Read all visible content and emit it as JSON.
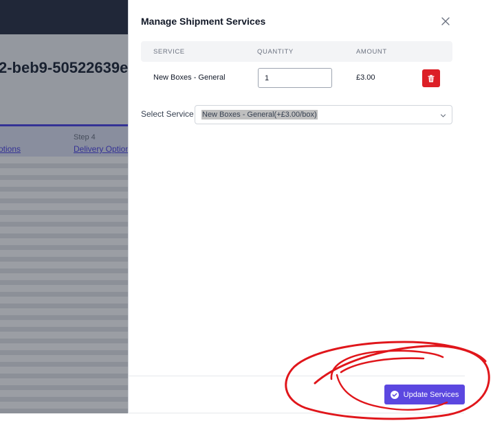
{
  "background": {
    "heading_fragment": "2-beb9-50522639e",
    "step_label": "Step 4",
    "step_link": "Delivery Options",
    "prev_step_link": "otions"
  },
  "modal": {
    "title": "Manage Shipment Services",
    "table": {
      "headers": [
        "SERVICE",
        "QUANTITY",
        "AMOUNT"
      ],
      "rows": [
        {
          "service": "New Boxes - General",
          "quantity": "1",
          "amount": "£3.00"
        }
      ]
    },
    "select": {
      "label": "Select Service",
      "value": "New Boxes - General(+£3.00/box)"
    },
    "update_button": {
      "label": "Update Services"
    }
  },
  "icons": {
    "close": "close-icon",
    "delete": "trash-icon",
    "chevron": "chevron-down-icon",
    "check": "check-circle-icon"
  },
  "colors": {
    "accent": "#5b47e0",
    "danger": "#dc1f26",
    "annotation": "#e0161b"
  }
}
